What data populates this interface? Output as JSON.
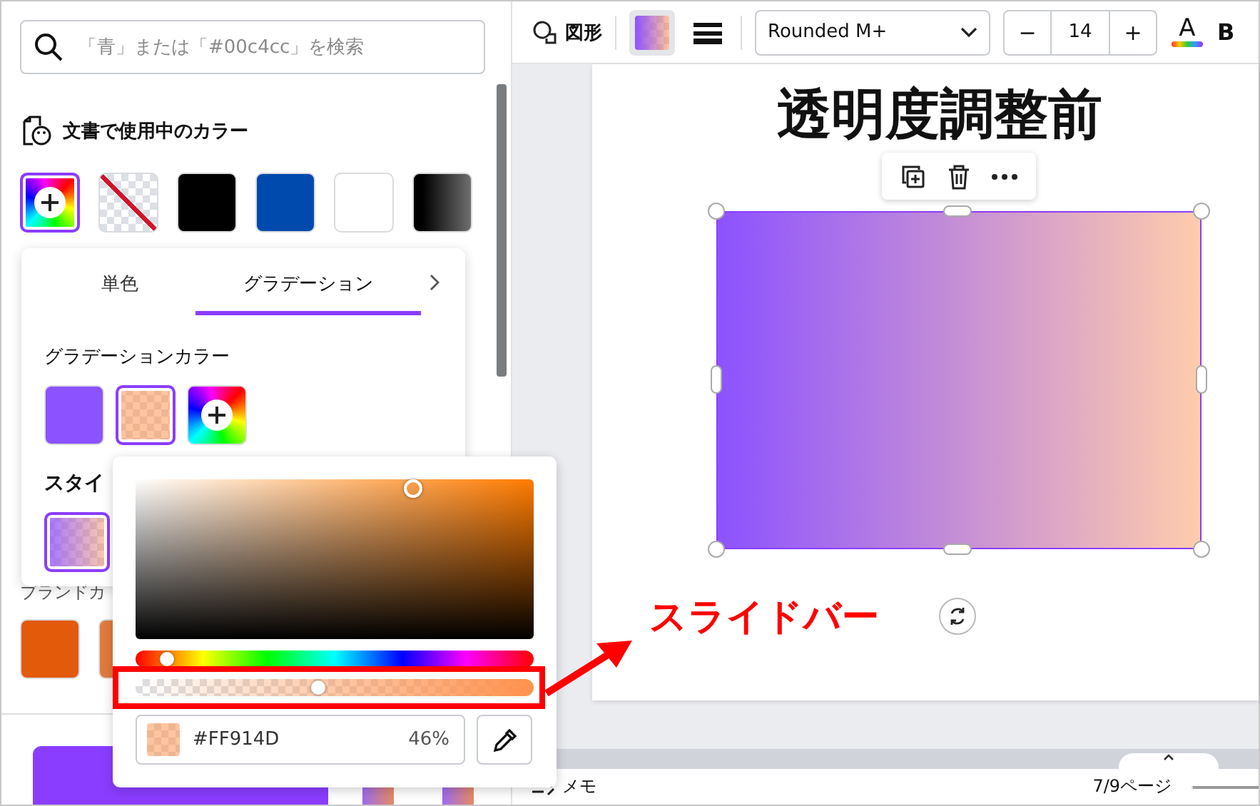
{
  "search": {
    "placeholder": "「青」または「#00c4cc」を検索"
  },
  "document_colors": {
    "title": "文書で使用中のカラー",
    "swatches": [
      {
        "kind": "add",
        "selected": true
      },
      {
        "kind": "transparent",
        "selected": false
      },
      {
        "kind": "solid",
        "color": "#000000",
        "selected": false
      },
      {
        "kind": "solid",
        "color": "#004aad",
        "selected": false
      },
      {
        "kind": "solid",
        "color": "#ffffff",
        "selected": false
      },
      {
        "kind": "gradient",
        "selected": false
      }
    ]
  },
  "brand_colors": {
    "title": "ブランドカ",
    "swatches": [
      {
        "kind": "solid",
        "color": "#e35a0a",
        "selected": false
      },
      {
        "kind": "solid",
        "color": "#e27a3c",
        "selected": false
      }
    ]
  },
  "gradient_popup": {
    "tabs": [
      {
        "label": "単色",
        "selected": false
      },
      {
        "label": "グラデーション",
        "selected": true
      }
    ],
    "colors_title": "グラデーションカラー",
    "stops": [
      {
        "kind": "solid",
        "color": "#8c52ff",
        "selected": false
      },
      {
        "kind": "tint",
        "selected": true
      },
      {
        "kind": "add",
        "selected": false
      }
    ],
    "style_title": "スタイ",
    "styles": [
      {
        "selected": true
      }
    ]
  },
  "color_picker": {
    "hue": {
      "level": 0.08
    },
    "alpha": {
      "level": 0.46
    },
    "hex": "#FF914D",
    "opacity": "46%"
  },
  "annotation": {
    "label": "スライドバー"
  },
  "toolbar": {
    "shape_label": "図形",
    "font": "Rounded M+",
    "minus": "−",
    "font_size": "14",
    "plus": "+",
    "text_color_letter": "A",
    "bold_letter": "B"
  },
  "canvas": {
    "title": "透明度調整前"
  },
  "footer": {
    "notes": "メモ",
    "page": "7/9ページ"
  }
}
